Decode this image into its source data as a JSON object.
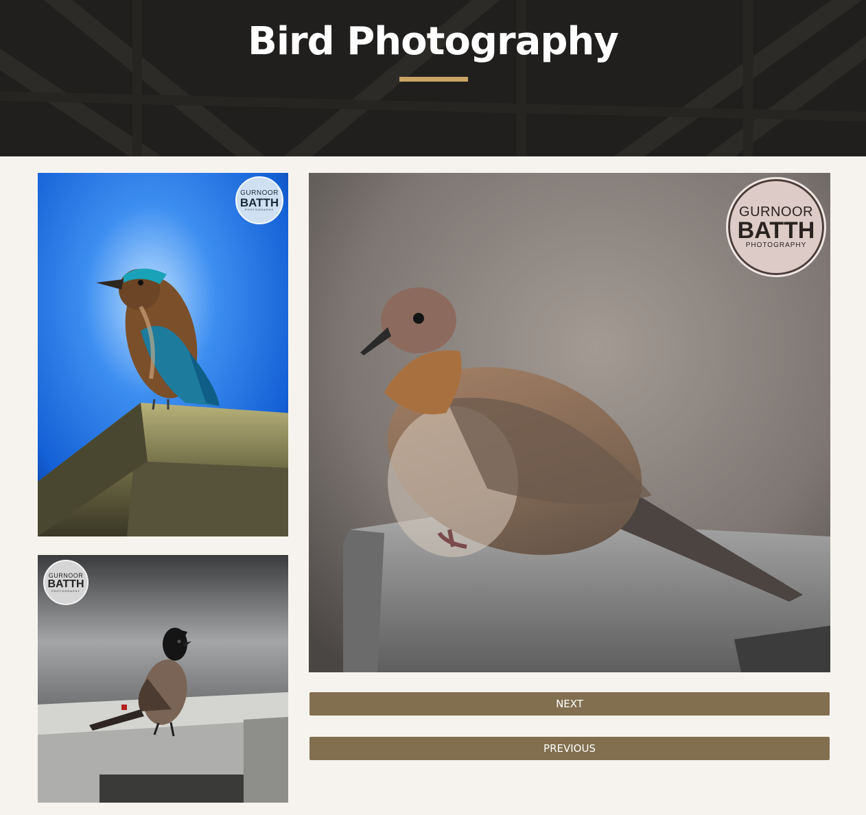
{
  "header": {
    "title": "Bird Photography",
    "accent_color": "#c9a464"
  },
  "gallery": {
    "thumbnails": [
      {
        "subject": "Indian roller",
        "watermark": {
          "line1": "GURNOOR",
          "line2": "BATTH",
          "line3": "PHOTOGRAPHY"
        }
      },
      {
        "subject": "Red-vented bulbul",
        "watermark": {
          "line1": "GURNOOR",
          "line2": "BATTH",
          "line3": "PHOTOGRAPHY"
        }
      }
    ],
    "main": {
      "subject": "Laughing dove",
      "watermark": {
        "line1": "GURNOOR",
        "line2": "BATTH",
        "line3": "PHOTOGRAPHY"
      }
    }
  },
  "controls": {
    "next_label": "NEXT",
    "previous_label": "PREVIOUS",
    "button_color": "#826f4f"
  }
}
